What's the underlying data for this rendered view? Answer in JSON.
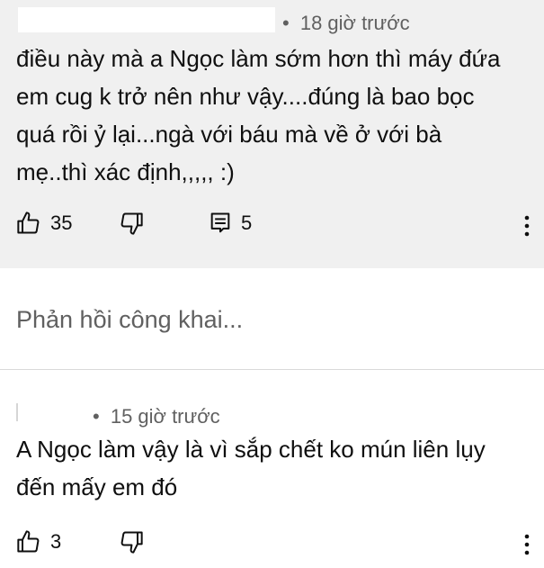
{
  "comments": [
    {
      "time": "18 giờ trước",
      "text": "điều này mà a Ngọc làm sớm hơn thì máy đứa em cug k trở nên như vậy....đúng là bao bọc quá rồi ỷ lại...ngà với báu mà về ở với bà mẹ..thì xác định,,,,, :)",
      "likes": "35",
      "replies": "5"
    },
    {
      "time": "15 giờ trước",
      "text": "A Ngọc làm vậy là vì sắp chết ko mún liên lụy đến mấy em đó",
      "likes": "3"
    }
  ],
  "reply_box": {
    "placeholder": "Phản hồi công khai..."
  },
  "meta_separator": "•",
  "icons": [
    "thumb-up-icon",
    "thumb-down-icon",
    "reply-icon",
    "more-vert-icon"
  ]
}
